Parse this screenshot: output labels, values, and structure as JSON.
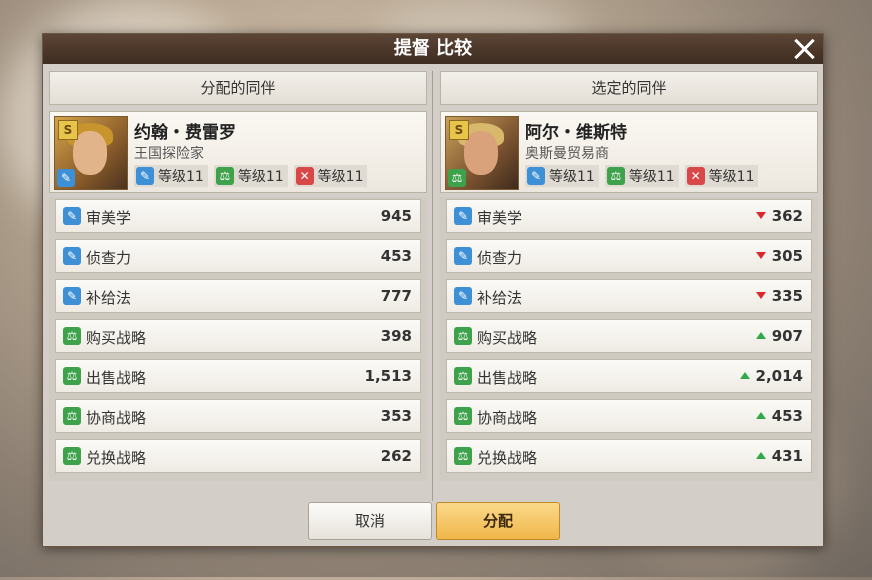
{
  "window": {
    "title": "提督 比较"
  },
  "left": {
    "header": "分配的同伴",
    "name": "约翰・费雷罗",
    "role": "王国探险家",
    "portrait_badge": "S",
    "portrait_type_icon": "brush-icon",
    "levels": [
      {
        "icon": "brush-icon",
        "color": "#3d8fd6",
        "label": "等级11"
      },
      {
        "icon": "scales-icon",
        "color": "#3da24a",
        "label": "等级11"
      },
      {
        "icon": "swords-icon",
        "color": "#d84848",
        "label": "等级11"
      }
    ],
    "stats": [
      {
        "icon": "brush-icon",
        "label": "审美学",
        "value": "945"
      },
      {
        "icon": "brush-icon",
        "label": "侦查力",
        "value": "453"
      },
      {
        "icon": "brush-icon",
        "label": "补给法",
        "value": "777"
      },
      {
        "icon": "scales-icon",
        "label": "购买战略",
        "value": "398"
      },
      {
        "icon": "scales-icon",
        "label": "出售战略",
        "value": "1,513"
      },
      {
        "icon": "scales-icon",
        "label": "协商战略",
        "value": "353"
      },
      {
        "icon": "scales-icon",
        "label": "兑换战略",
        "value": "262"
      }
    ]
  },
  "right": {
    "header": "选定的同伴",
    "name": "阿尔・维斯特",
    "role": "奥斯曼贸易商",
    "portrait_badge": "S",
    "portrait_type_icon": "scales-icon",
    "levels": [
      {
        "icon": "brush-icon",
        "color": "#3d8fd6",
        "label": "等级11"
      },
      {
        "icon": "scales-icon",
        "color": "#3da24a",
        "label": "等级11"
      },
      {
        "icon": "swords-icon",
        "color": "#d84848",
        "label": "等级11"
      }
    ],
    "stats": [
      {
        "icon": "brush-icon",
        "label": "审美学",
        "value": "362",
        "trend": "down"
      },
      {
        "icon": "brush-icon",
        "label": "侦查力",
        "value": "305",
        "trend": "down"
      },
      {
        "icon": "brush-icon",
        "label": "补给法",
        "value": "335",
        "trend": "down"
      },
      {
        "icon": "scales-icon",
        "label": "购买战略",
        "value": "907",
        "trend": "up"
      },
      {
        "icon": "scales-icon",
        "label": "出售战略",
        "value": "2,014",
        "trend": "up"
      },
      {
        "icon": "scales-icon",
        "label": "协商战略",
        "value": "453",
        "trend": "up"
      },
      {
        "icon": "scales-icon",
        "label": "兑换战略",
        "value": "431",
        "trend": "up"
      }
    ]
  },
  "buttons": {
    "cancel": "取消",
    "assign": "分配"
  },
  "colors": {
    "up": "#2fa84a",
    "down": "#d82a2a",
    "assign_button": "#f0b74a"
  }
}
